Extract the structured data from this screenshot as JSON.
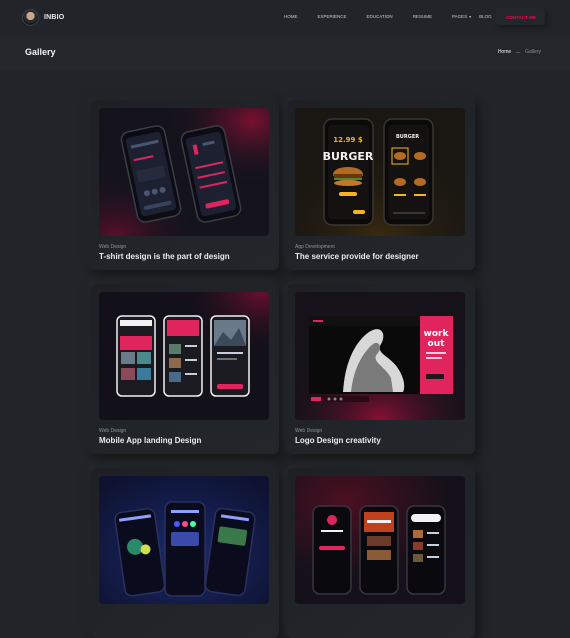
{
  "header": {
    "brand": "INBIO",
    "nav": [
      {
        "label": "HOME"
      },
      {
        "label": "EXPERIENCE"
      },
      {
        "label": "EDUCATION"
      },
      {
        "label": "RESUME"
      },
      {
        "label": "PAGES",
        "dropdown": true
      },
      {
        "label": "BLOG"
      },
      {
        "label": "FOOTER"
      }
    ],
    "contact_label": "CONTACT ME"
  },
  "titlebar": {
    "title": "Gallery",
    "breadcrumb_home": "Home",
    "breadcrumb_current": "Gallery"
  },
  "colors": {
    "accent": "#ff014f",
    "background": "#212428"
  },
  "gallery": {
    "items": [
      {
        "category": "Web Design",
        "title": "T-shirt design is the part of design"
      },
      {
        "category": "App Development",
        "title": "The service provide for designer"
      },
      {
        "category": "Web Design",
        "title": "Mobile App landing Design"
      },
      {
        "category": "Web Design",
        "title": "Logo Design creativity"
      },
      {
        "category": "",
        "title": ""
      },
      {
        "category": "",
        "title": ""
      }
    ],
    "thumb_text": {
      "burger_price": "12.99 $",
      "burger_word": "BURGER",
      "burger_small": "BURGER",
      "workout_line1": "work",
      "workout_line2": "out"
    }
  }
}
